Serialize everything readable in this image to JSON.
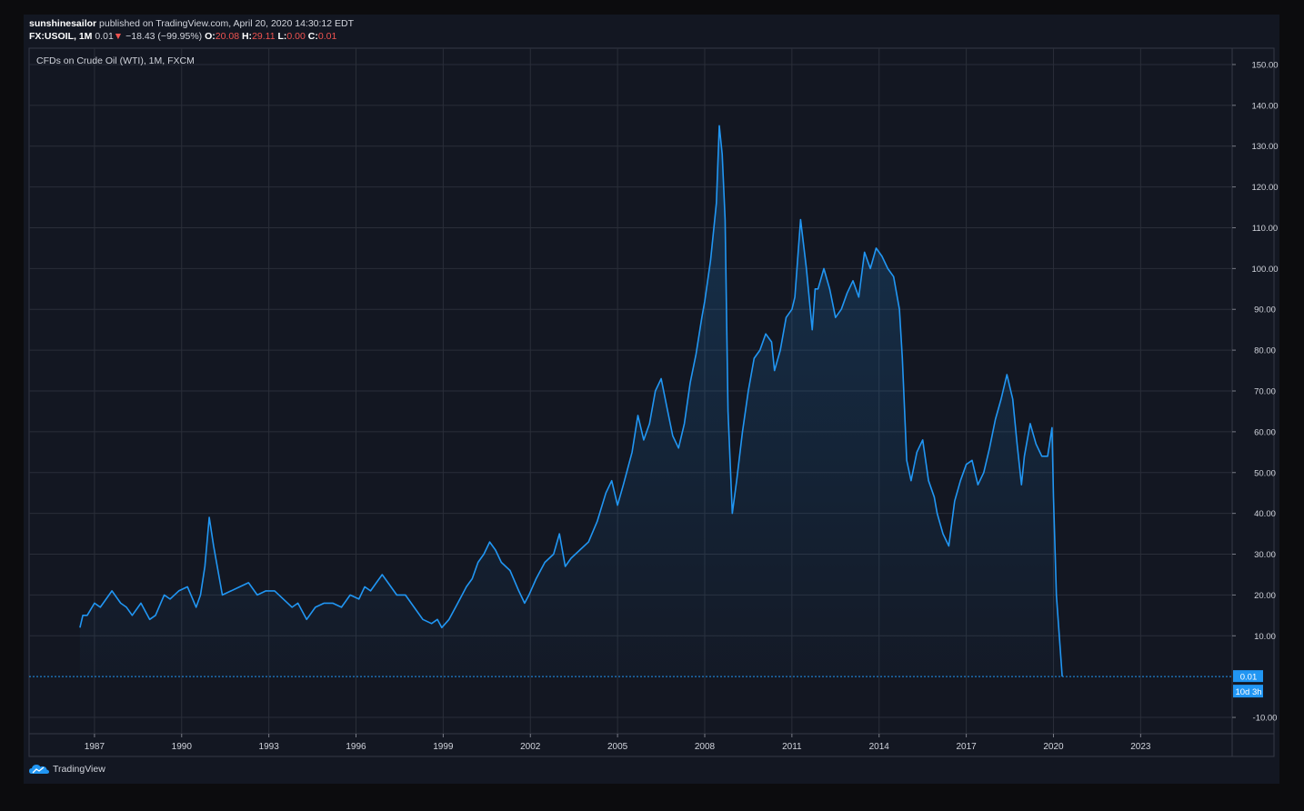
{
  "header": {
    "author": "sunshinesailor",
    "published_text": "published on TradingView.com, April 20, 2020 14:30:12 EDT",
    "symbol": "FX:USOIL, 1M",
    "last": "0.01",
    "down_arrow": "▼",
    "change": "−18.43 (−99.95%)",
    "o_label": "O:",
    "o_value": "20.08",
    "h_label": "H:",
    "h_value": "29.11",
    "l_label": "L:",
    "l_value": "0.00",
    "c_label": "C:",
    "c_value": "0.01"
  },
  "legend": {
    "title": "CFDs on Crude Oil (WTI), 1M, FXCM"
  },
  "price_badge": {
    "value": "0.01",
    "countdown": "10d 3h"
  },
  "footer": {
    "brand": "TradingView"
  },
  "colors": {
    "background": "#131722",
    "line": "#2196f3",
    "grid": "#2a2e39",
    "badge": "#2196f3",
    "down": "#ef5350"
  },
  "chart_data": {
    "type": "area",
    "xlabel": "",
    "ylabel": "",
    "ylim": [
      -14,
      154
    ],
    "xlim": [
      1984.75,
      2026.15
    ],
    "y_ticks": [
      "150.00",
      "140.00",
      "130.00",
      "120.00",
      "110.00",
      "100.00",
      "90.00",
      "80.00",
      "70.00",
      "60.00",
      "50.00",
      "40.00",
      "30.00",
      "20.00",
      "10.00",
      "-10.00"
    ],
    "y_tick_values": [
      150,
      140,
      130,
      120,
      110,
      100,
      90,
      80,
      70,
      60,
      50,
      40,
      30,
      20,
      10,
      -10
    ],
    "x_ticks": [
      "1987",
      "1990",
      "1993",
      "1996",
      "1999",
      "2002",
      "2005",
      "2008",
      "2011",
      "2014",
      "2017",
      "2020",
      "2023"
    ],
    "x_tick_values": [
      1987,
      1990,
      1993,
      1996,
      1999,
      2002,
      2005,
      2008,
      2011,
      2014,
      2017,
      2020,
      2023
    ],
    "series": [
      {
        "x": [
          1986.5,
          1986.6,
          1986.75,
          1987.0,
          1987.2,
          1987.4,
          1987.6,
          1987.9,
          1988.1,
          1988.3,
          1988.6,
          1988.9,
          1989.1,
          1989.4,
          1989.6,
          1989.9,
          1990.2,
          1990.5,
          1990.65,
          1990.8,
          1990.95,
          1991.1,
          1991.4,
          1991.7,
          1992.0,
          1992.3,
          1992.6,
          1992.9,
          1993.2,
          1993.5,
          1993.8,
          1994.0,
          1994.3,
          1994.6,
          1994.9,
          1995.2,
          1995.5,
          1995.8,
          1996.1,
          1996.3,
          1996.5,
          1996.7,
          1996.9,
          1997.1,
          1997.4,
          1997.7,
          1998.0,
          1998.3,
          1998.6,
          1998.8,
          1998.95,
          1999.2,
          1999.5,
          1999.8,
          2000.0,
          2000.2,
          2000.4,
          2000.6,
          2000.8,
          2001.0,
          2001.3,
          2001.6,
          2001.8,
          2001.95,
          2002.2,
          2002.5,
          2002.8,
          2003.0,
          2003.2,
          2003.4,
          2003.7,
          2004.0,
          2004.3,
          2004.6,
          2004.8,
          2005.0,
          2005.2,
          2005.5,
          2005.7,
          2005.9,
          2006.1,
          2006.3,
          2006.5,
          2006.7,
          2006.9,
          2007.1,
          2007.3,
          2007.5,
          2007.7,
          2007.9,
          2008.0,
          2008.2,
          2008.4,
          2008.5,
          2008.6,
          2008.7,
          2008.8,
          2008.95,
          2009.1,
          2009.3,
          2009.5,
          2009.7,
          2009.9,
          2010.1,
          2010.3,
          2010.4,
          2010.6,
          2010.8,
          2011.0,
          2011.1,
          2011.3,
          2011.5,
          2011.7,
          2011.8,
          2011.9,
          2012.1,
          2012.3,
          2012.5,
          2012.7,
          2012.9,
          2013.1,
          2013.3,
          2013.5,
          2013.7,
          2013.9,
          2014.1,
          2014.3,
          2014.5,
          2014.7,
          2014.8,
          2014.95,
          2015.1,
          2015.3,
          2015.5,
          2015.7,
          2015.9,
          2016.0,
          2016.2,
          2016.4,
          2016.6,
          2016.8,
          2017.0,
          2017.2,
          2017.4,
          2017.6,
          2017.8,
          2018.0,
          2018.2,
          2018.4,
          2018.6,
          2018.75,
          2018.9,
          2019.0,
          2019.2,
          2019.4,
          2019.6,
          2019.8,
          2019.95,
          2020.0,
          2020.1,
          2020.3
        ],
        "values": [
          12,
          15,
          15,
          18,
          17,
          19,
          21,
          18,
          17,
          15,
          18,
          14,
          15,
          20,
          19,
          21,
          22,
          17,
          20,
          27,
          39,
          32,
          20,
          21,
          22,
          23,
          20,
          21,
          21,
          19,
          17,
          18,
          14,
          17,
          18,
          18,
          17,
          20,
          19,
          22,
          21,
          23,
          25,
          23,
          20,
          20,
          17,
          14,
          13,
          14,
          12,
          14,
          18,
          22,
          24,
          28,
          30,
          33,
          31,
          28,
          26,
          21,
          18,
          20,
          24,
          28,
          30,
          35,
          27,
          29,
          31,
          33,
          38,
          45,
          48,
          42,
          47,
          55,
          64,
          58,
          62,
          70,
          73,
          66,
          59,
          56,
          62,
          72,
          79,
          88,
          92,
          102,
          116,
          135,
          128,
          112,
          65,
          40,
          48,
          60,
          70,
          78,
          80,
          84,
          82,
          75,
          80,
          88,
          90,
          93,
          112,
          100,
          85,
          95,
          95,
          100,
          95,
          88,
          90,
          94,
          97,
          93,
          104,
          100,
          105,
          103,
          100,
          98,
          90,
          78,
          53,
          48,
          55,
          58,
          48,
          44,
          40,
          35,
          32,
          43,
          48,
          52,
          53,
          47,
          50,
          56,
          63,
          68,
          74,
          68,
          57,
          47,
          54,
          62,
          57,
          54,
          54,
          61,
          44,
          20,
          0.01
        ]
      }
    ],
    "last_value": 0.01
  }
}
